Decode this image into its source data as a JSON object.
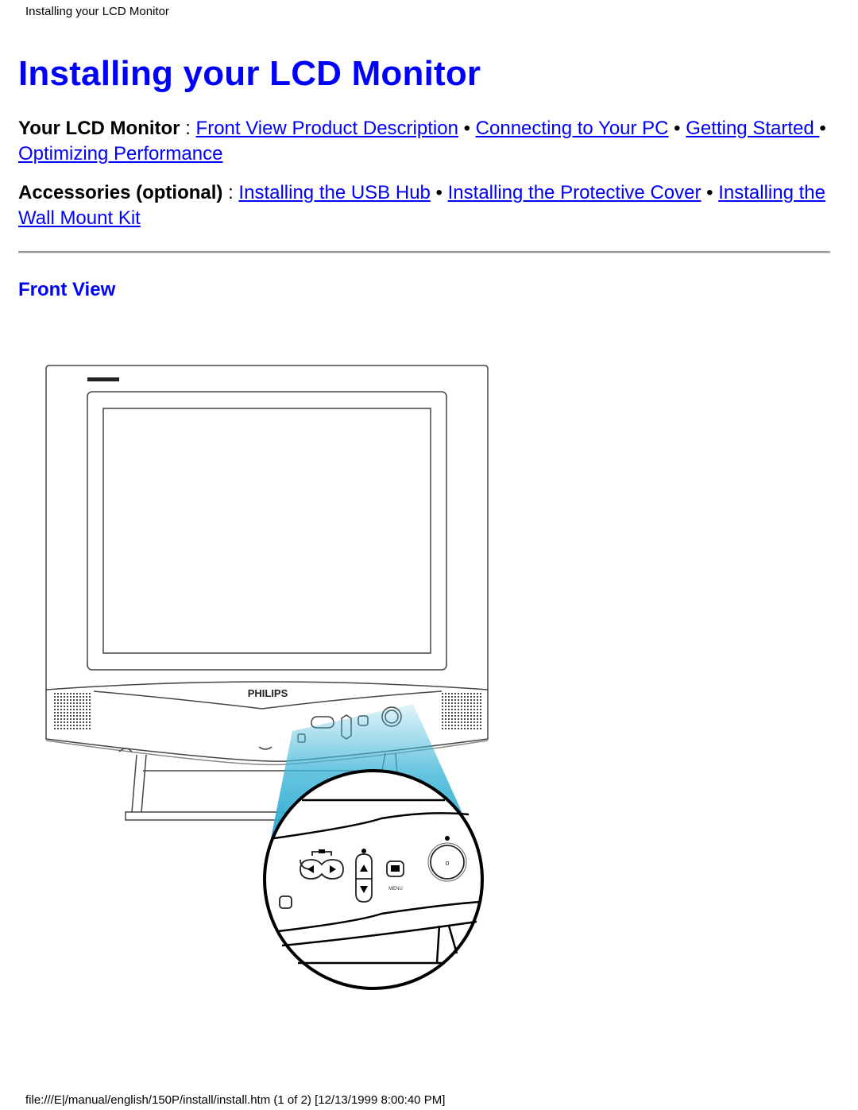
{
  "header": {
    "title": "Installing your LCD Monitor"
  },
  "page_title": "Installing your LCD Monitor",
  "nav_monitor": {
    "label": "Your LCD Monitor",
    "sep": " : ",
    "links": [
      "Front View Product Description",
      "Connecting to Your PC",
      "Getting Started ",
      "Optimizing Performance"
    ]
  },
  "nav_accessories": {
    "label": "Accessories (optional)",
    "sep": " : ",
    "links": [
      "Installing the USB Hub",
      "Installing the Protective Cover",
      "Installing the Wall Mount Kit"
    ]
  },
  "bullet": " • ",
  "section_title": "Front View",
  "figure": {
    "brand": "PHILIPS",
    "menu_label": "MENU",
    "accent_color": "#3fb6d8"
  },
  "footer": {
    "text": "file:///E|/manual/english/150P/install/install.htm (1 of 2) [12/13/1999 8:00:40 PM]"
  }
}
